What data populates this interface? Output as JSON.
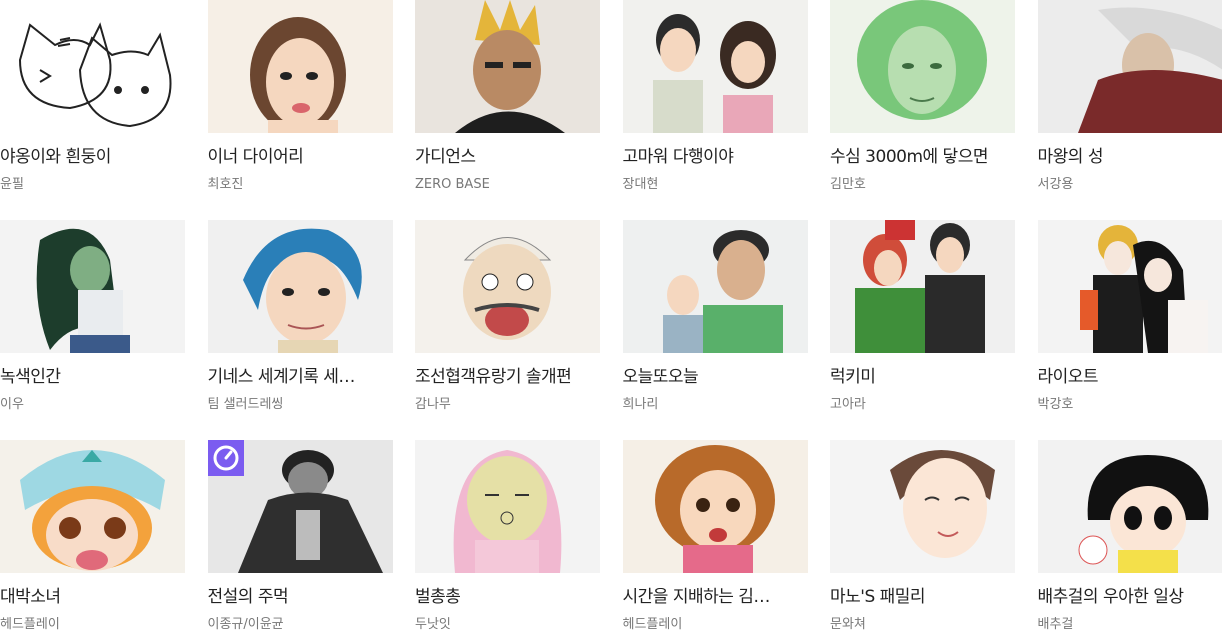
{
  "webtoons": [
    {
      "title": "야옹이와 흰둥이",
      "author": "윤필",
      "thumb_icon": "cats-drawing",
      "bg": "#ffffff"
    },
    {
      "title": "이너 다이어리",
      "author": "최호진",
      "thumb_icon": "woman-portrait",
      "bg": "#f6efe6"
    },
    {
      "title": "가디언스",
      "author": "ZERO BASE",
      "thumb_icon": "spiky-hair-man",
      "bg": "#e9e4de"
    },
    {
      "title": "고마워 다행이야",
      "author": "장대현",
      "thumb_icon": "couple-portrait",
      "bg": "#f1f1ee"
    },
    {
      "title": "수심 3000m에 닿으면",
      "author": "김만호",
      "thumb_icon": "green-woman",
      "bg": "#eef3ea"
    },
    {
      "title": "마왕의 성",
      "author": "서강용",
      "thumb_icon": "demon-lord",
      "bg": "#ececec"
    },
    {
      "title": "녹색인간",
      "author": "이우",
      "thumb_icon": "green-human",
      "bg": "#f3f3f3"
    },
    {
      "title": "기네스 세계기록 세…",
      "author": "팀 샐러드레씽",
      "thumb_icon": "blue-hair-man",
      "bg": "#f0f0f0"
    },
    {
      "title": "조선협객유랑기 솔개편",
      "author": "감나무",
      "thumb_icon": "laughing-man",
      "bg": "#f4f1ec"
    },
    {
      "title": "오늘또오늘",
      "author": "희나리",
      "thumb_icon": "two-men",
      "bg": "#eef0f0"
    },
    {
      "title": "럭키미",
      "author": "고아라",
      "thumb_icon": "couple-green-coat",
      "bg": "#f0f0f0"
    },
    {
      "title": "라이오트",
      "author": "박강호",
      "thumb_icon": "two-girls",
      "bg": "#f3f3f3"
    },
    {
      "title": "대박소녀",
      "author": "헤드플레이",
      "thumb_icon": "crying-girl",
      "bg": "#f4f1ea"
    },
    {
      "title": "전설의 주먹",
      "author": "이종규/이윤균",
      "thumb_icon": "fist-fighter",
      "bg": "#f2f2f2",
      "badge": "clock-icon"
    },
    {
      "title": "벌총총",
      "author": "두낫잇",
      "thumb_icon": "pink-hood-character",
      "bg": "#f3f3f3"
    },
    {
      "title": "시간을 지배하는 김…",
      "author": "헤드플레이",
      "thumb_icon": "phone-girl",
      "bg": "#f5efe6"
    },
    {
      "title": "마노'S 패밀리",
      "author": "문와쳐",
      "thumb_icon": "smiling-woman",
      "bg": "#f4f4f4"
    },
    {
      "title": "배추걸의 우아한 일상",
      "author": "배추걸",
      "thumb_icon": "bob-hair-girl",
      "bg": "#f2f2f2"
    }
  ]
}
